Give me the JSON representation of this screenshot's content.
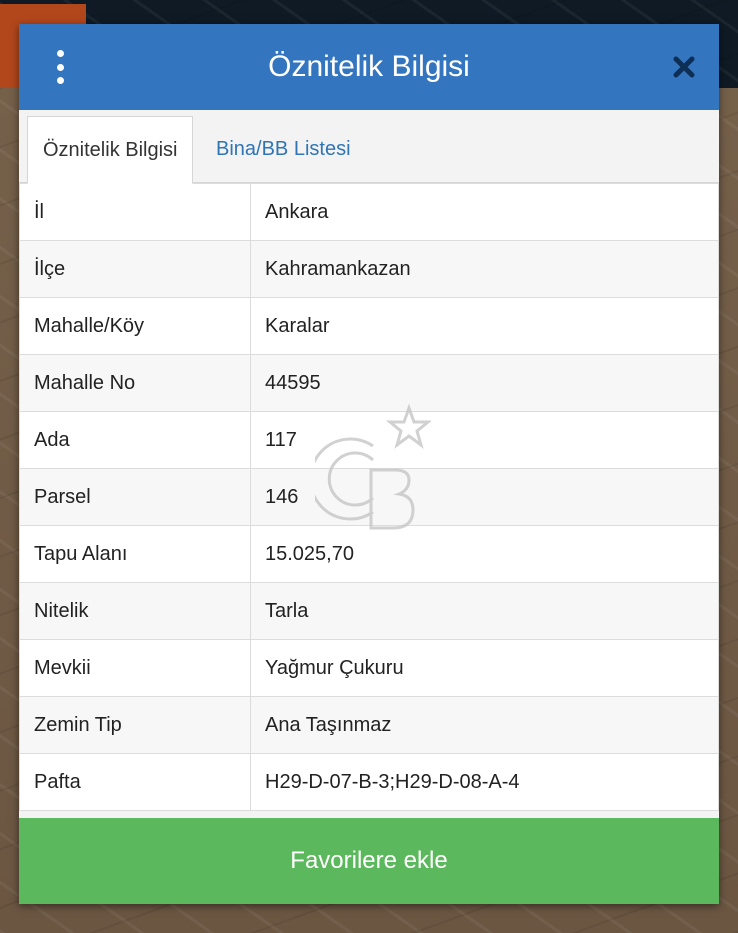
{
  "dialog": {
    "title": "Öznitelik Bilgisi",
    "menu_icon": "more-vertical-icon",
    "close_icon": "close-icon"
  },
  "tabs": [
    {
      "label": "Öznitelik Bilgisi",
      "active": true
    },
    {
      "label": "Bina/BB Listesi",
      "active": false
    }
  ],
  "rows": [
    {
      "key": "İl",
      "value": "Ankara"
    },
    {
      "key": "İlçe",
      "value": "Kahramankazan"
    },
    {
      "key": "Mahalle/Köy",
      "value": "Karalar"
    },
    {
      "key": "Mahalle No",
      "value": "44595"
    },
    {
      "key": "Ada",
      "value": "117"
    },
    {
      "key": "Parsel",
      "value": "146"
    },
    {
      "key": "Tapu Alanı",
      "value": "15.025,70"
    },
    {
      "key": "Nitelik",
      "value": "Tarla"
    },
    {
      "key": "Mevkii",
      "value": "Yağmur Çukuru"
    },
    {
      "key": "Zemin Tip",
      "value": "Ana Taşınmaz"
    },
    {
      "key": "Pafta",
      "value": "H29-D-07-B-3;H29-D-08-A-4"
    }
  ],
  "favorite_button": "Favorilere ekle",
  "colors": {
    "header": "#3375bf",
    "tab_link": "#2f74b5",
    "favorite": "#5cb85c"
  }
}
